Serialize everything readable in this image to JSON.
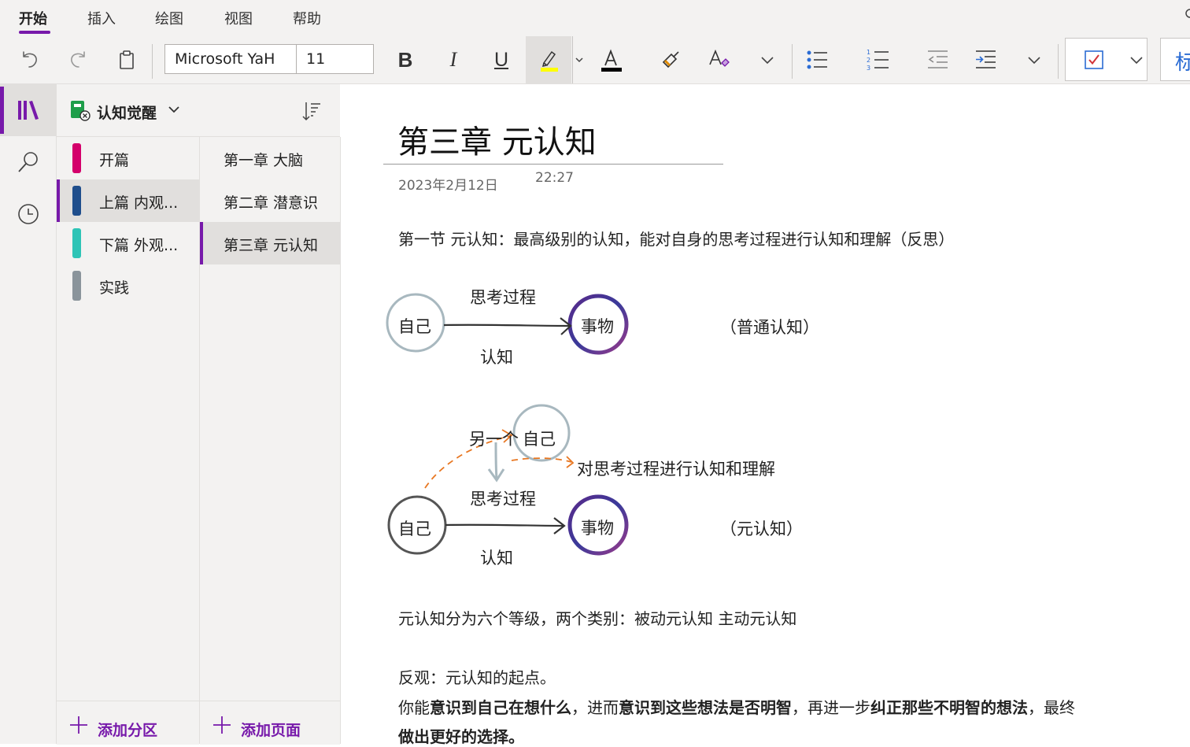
{
  "ribbon": {
    "tabs": [
      "开始",
      "插入",
      "绘图",
      "视图",
      "帮助"
    ],
    "font_name": "Microsoft YaH",
    "font_size": "11",
    "highlight_color": "#ffff00",
    "font_color": "#000000",
    "style_partial": "标"
  },
  "notebook": {
    "name": "认知觉醒",
    "sections": [
      {
        "label": "开篇",
        "color": "#d4006b"
      },
      {
        "label": "上篇 内观...",
        "color": "#1f4e8c"
      },
      {
        "label": "下篇 外观...",
        "color": "#2ec4b6"
      },
      {
        "label": "实践",
        "color": "#8a949b"
      }
    ],
    "pages": [
      "第一章 大脑",
      "第二章 潜意识",
      "第三章 元认知"
    ],
    "add_section": "添加分区",
    "add_page": "添加页面"
  },
  "page": {
    "title": "第三章 元认知",
    "date": "2023年2月12日",
    "time": "22:27",
    "line1": "第一节  元认知：最高级别的认知，能对自身的思考过程进行认知和理解（反思）",
    "diagram1": {
      "self": "自己",
      "thing": "事物",
      "above": "思考过程",
      "below": "认知",
      "note": "（普通认知）"
    },
    "diagram2": {
      "other_prefix": "另一个",
      "other_self": "自己",
      "reflect": "对思考过程进行认知和理解",
      "above": "思考过程",
      "self": "自己",
      "thing": "事物",
      "below": "认知",
      "note": "（元认知）"
    },
    "line2": "元认知分为六个等级，两个类别：被动元认知   主动元认知",
    "line3": "反观：元认知的起点。",
    "line4": {
      "t1": "你能",
      "b1": "意识到自己在想什么",
      "t2": "，进而",
      "b2": "意识到这些想法是否明智",
      "t3": "，再进一步",
      "b3": "纠正那些不明智的想法",
      "t4": "，最终"
    },
    "line5": "做出更好的选择。"
  }
}
